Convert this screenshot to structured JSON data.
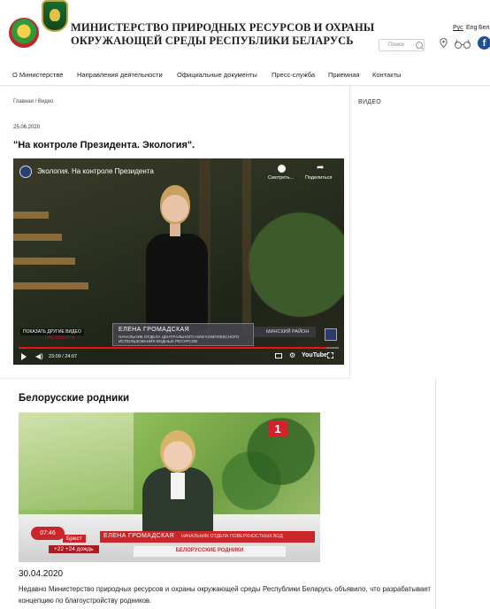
{
  "header": {
    "site_title_line1": "МИНИСТЕРСТВО ПРИРОДНЫХ РЕСУРСОВ И ОХРАНЫ",
    "site_title_line2": "ОКРУЖАЮЩЕЙ СРЕДЫ РЕСПУБЛИКИ БЕЛАРУСЬ",
    "search_placeholder": "Поиск",
    "languages": [
      "Рус",
      "Eng",
      "Бел"
    ],
    "facebook_glyph": "f"
  },
  "nav": {
    "items": [
      "О Министерстве",
      "Направления деятельности",
      "Официальные документы",
      "Пресс-служба",
      "Приемная",
      "Контакты"
    ]
  },
  "breadcrumb": "Главная / Видео",
  "sidebar": {
    "heading": "ВИДЕО"
  },
  "video1": {
    "date": "25.06.2020",
    "title": "\"На контроле Президента. Экология\".",
    "player": {
      "video_title": "Экология. На контроле Президента",
      "watch_later": "Смотреть...",
      "share": "Поделиться",
      "more_videos": "ПОКАЗАТЬ ДРУГИЕ ВИДЕО",
      "more_videos_sub": "ПРЕЗИДЕНТА",
      "lower_third_name": "ЕЛЕНА ГРОМАДСКАЯ",
      "lower_third_role": "НАЧАЛЬНИК ОТДЕЛА ЦЕНТРАЛЬНОГО НИИ КОМПЛЕКСНОГО ИСПОЛЬЗОВАНИЯ ВОДНЫХ РЕСУРСОВ",
      "region": "МИНСКИЙ РАЙОН",
      "time": "23:09 / 24:07",
      "progress": 0.96,
      "youtube_label": "YouTube"
    }
  },
  "video2": {
    "section_title": "Белорусские родники",
    "channel_logo": "1",
    "clock": "07:46",
    "city": "Брест",
    "weather": "+22 +24 дождь",
    "name": "ЕЛЕНА ГРОМАДСКАЯ",
    "role": "НАЧАЛЬНИК ОТДЕЛА ПОВЕРХНОСТНЫХ ВОД",
    "topic": "БЕЛОРУССКИЕ РОДНИКИ",
    "date": "30.04.2020",
    "text": "Недавно Министерство природных ресурсов и охраны окружающей среды Республики Беларусь объявило, что разрабатывает концепцию по благоустройству родников."
  },
  "colors": {
    "accent_red": "#c9262c",
    "facebook_blue": "#1d4f9c",
    "youtube_red": "#ee1111"
  }
}
